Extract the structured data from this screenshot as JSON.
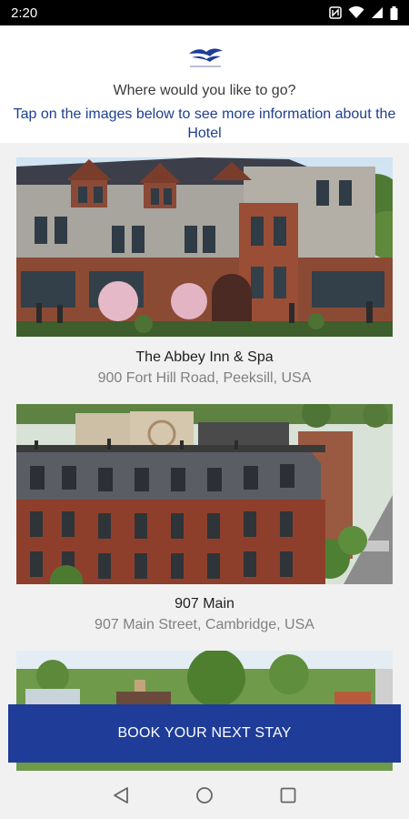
{
  "status_bar": {
    "time": "2:20",
    "icons": [
      "nfc-icon",
      "wifi-icon",
      "cell-signal-icon",
      "battery-icon"
    ]
  },
  "header": {
    "logo_icon": "brand-logo-icon",
    "question": "Where would you like to go?",
    "subtitle": "Tap on the images below to see more information about the Hotel"
  },
  "hotels": [
    {
      "name": "The Abbey Inn & Spa",
      "address": "900 Fort Hill Road, Peeksill, USA"
    },
    {
      "name": "907 Main",
      "address": "907 Main Street, Cambridge, USA"
    }
  ],
  "book_button": {
    "label": "BOOK YOUR NEXT STAY"
  },
  "nav_bar": {
    "icons": [
      "back-icon",
      "home-icon",
      "recents-icon"
    ]
  },
  "colors": {
    "accent": "#1e3c98",
    "link_text": "#1f3f8f",
    "list_background": "#f1f1f1"
  }
}
